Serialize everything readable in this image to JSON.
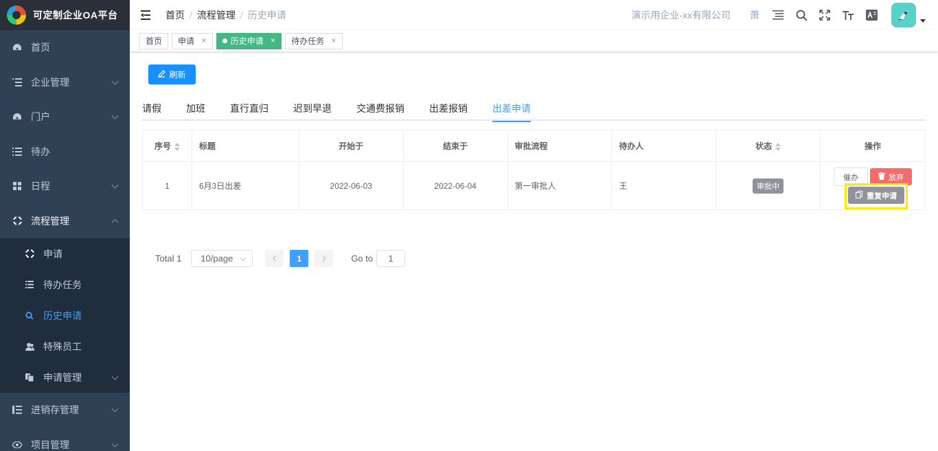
{
  "app": {
    "title": "可定制企业OA平台",
    "logo_icon": "logo-icon"
  },
  "sidebar": {
    "items": [
      {
        "label": "首页",
        "icon": "dashboard-icon"
      },
      {
        "label": "企业管理",
        "icon": "list-tree-icon"
      },
      {
        "label": "门户",
        "icon": "dashboard-icon"
      },
      {
        "label": "待办",
        "icon": "list-icon"
      },
      {
        "label": "日程",
        "icon": "grid-icon"
      },
      {
        "label": "流程管理",
        "icon": "process-icon"
      },
      {
        "label": "进销存管理",
        "icon": "list-tree-icon"
      },
      {
        "label": "项目管理",
        "icon": "eye-icon"
      }
    ],
    "subitems": [
      {
        "label": "申请",
        "icon": "process-icon"
      },
      {
        "label": "待办任务",
        "icon": "list-icon"
      },
      {
        "label": "历史申请",
        "icon": "search-icon"
      },
      {
        "label": "特殊员工",
        "icon": "users-icon"
      },
      {
        "label": "申请管理",
        "icon": "documents-icon"
      }
    ]
  },
  "navbar": {
    "breadcrumb": [
      "首页",
      "流程管理",
      "历史申请"
    ],
    "company": "演示用企业-xx有限公司",
    "user_char": "萧",
    "icons": [
      "menu-icon",
      "search-icon",
      "fullscreen-icon",
      "font-size-icon",
      "translate-icon"
    ]
  },
  "tags": [
    {
      "label": "首页",
      "closable": false
    },
    {
      "label": "申请",
      "closable": true
    },
    {
      "label": "历史申请",
      "closable": true,
      "active": true
    },
    {
      "label": "待办任务",
      "closable": true
    }
  ],
  "toolbar": {
    "refresh_label": "刷新"
  },
  "tabs": [
    "请假",
    "加班",
    "直行直归",
    "迟到早退",
    "交通费报销",
    "出差报销",
    "出差申请"
  ],
  "active_tab": "出差申请",
  "table": {
    "columns": [
      "序号",
      "标题",
      "开始于",
      "结束于",
      "审批流程",
      "待办人",
      "状态",
      "操作"
    ],
    "rows": [
      {
        "index": "1",
        "title": "6月3日出差",
        "start": "2022-06-03",
        "end": "2022-06-04",
        "flow": "第一审批人",
        "assignee": "王",
        "status": "审批中",
        "actions": {
          "urge": "催办",
          "abandon": "放弃",
          "repeat": "重复申请"
        }
      }
    ]
  },
  "pagination": {
    "total": "Total 1",
    "page_size": "10/page",
    "current_page": "1",
    "goto_label": "Go to",
    "goto_value": "1"
  },
  "colors": {
    "sidebar_bg": "#304156",
    "primary": "#409eff",
    "tag_active": "#42b983",
    "danger": "#f56c6c",
    "highlight": "#ffea00"
  }
}
